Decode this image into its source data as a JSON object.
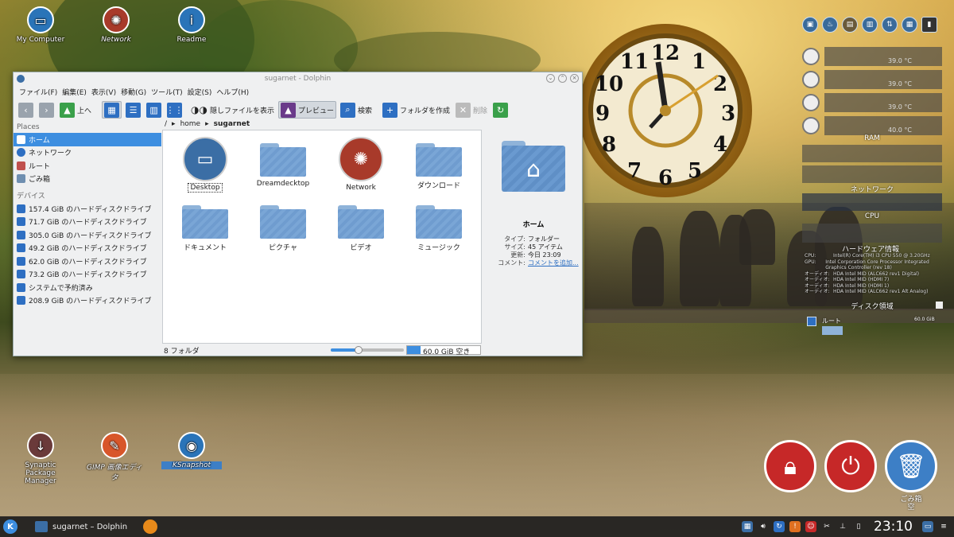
{
  "desktop": {
    "icons_top": [
      {
        "label": "My Computer"
      },
      {
        "label": "Network"
      },
      {
        "label": "Readme"
      }
    ],
    "icons_bottom": [
      {
        "label": "Synaptic Package Manager"
      },
      {
        "label": "GIMP 画像エディタ"
      },
      {
        "label": "KSnapshot"
      }
    ]
  },
  "window": {
    "title": "sugarnet - Dolphin",
    "menus": [
      "ファイル(F)",
      "編集(E)",
      "表示(V)",
      "移動(G)",
      "ツール(T)",
      "設定(S)",
      "ヘルプ(H)"
    ],
    "toolbar": {
      "up": "上へ",
      "hidden": "隠しファイルを表示",
      "preview": "プレビュー",
      "search": "検索",
      "new_folder": "フォルダを作成",
      "delete": "削除"
    },
    "sidebar": {
      "places_header": "Places",
      "places": [
        "ホーム",
        "ネットワーク",
        "ルート",
        "ごみ箱"
      ],
      "devices_header": "デバイス",
      "devices": [
        "157.4 GiB のハードディスクドライブ",
        "71.7 GiB のハードディスクドライブ",
        "305.0 GiB のハードディスクドライブ",
        "49.2 GiB のハードディスクドライブ",
        "62.0 GiB のハードディスクドライブ",
        "73.2 GiB のハードディスクドライブ",
        "システムで予約済み",
        "208.9 GiB のハードディスクドライブ"
      ]
    },
    "breadcrumb": {
      "root": "/",
      "home": "home",
      "current": "sugarnet"
    },
    "files": [
      "Desktop",
      "Dreamdecktop",
      "Network",
      "ダウンロード",
      "ドキュメント",
      "ピクチャ",
      "ビデオ",
      "ミュージック"
    ],
    "status": {
      "count": "8 フォルダ",
      "free": "60.0 GiB 空き",
      "zoom_fraction": 0.38,
      "used_fraction": 0.18
    },
    "info": {
      "title": "ホーム",
      "type_k": "タイプ:",
      "type_v": "フォルダー",
      "size_k": "サイズ:",
      "size_v": "45 アイテム",
      "modified_k": "更新:",
      "modified_v": "今日 23:09",
      "comment_k": "コメント:",
      "comment_v": "コメントを追加..."
    }
  },
  "widgets": {
    "temps": [
      "39.0 °C",
      "39.0 °C",
      "39.0 °C",
      "40.0 °C"
    ],
    "ram_label": "RAM",
    "network_label": "ネットワーク",
    "cpu_label": "CPU",
    "hw_title": "ハードウェア情報",
    "hw_rows": [
      {
        "k": "CPU:",
        "v": "Intel(R) Core(TM) i3 CPU 550 @ 3.20GHz"
      },
      {
        "k": "GPU:",
        "v": "Intel Corporation Core Processor Integrated Graphics Controller (rev 18)"
      },
      {
        "k": "オーディオ:",
        "v": "HDA Intel MID (ALC662 rev1 Digital)"
      },
      {
        "k": "オーディオ:",
        "v": "HDA Intel MID (HDMI 7)"
      },
      {
        "k": "オーディオ:",
        "v": "HDA Intel MID (HDMI 1)"
      },
      {
        "k": "オーディオ:",
        "v": "HDA Intel MID (ALC662 rev1 Alt Analog)"
      }
    ],
    "disk_title": "ディスク領域",
    "disk_name": "ルート",
    "disk_size": "60.0 GiB"
  },
  "actions": {
    "trash_label": "ごみ箱\n空"
  },
  "taskbar": {
    "task_label": "sugarnet – Dolphin",
    "time": "23:10"
  },
  "colors": {
    "accent": "#3d8ee0",
    "danger": "#c62828",
    "folder": "#6f9ccf"
  }
}
